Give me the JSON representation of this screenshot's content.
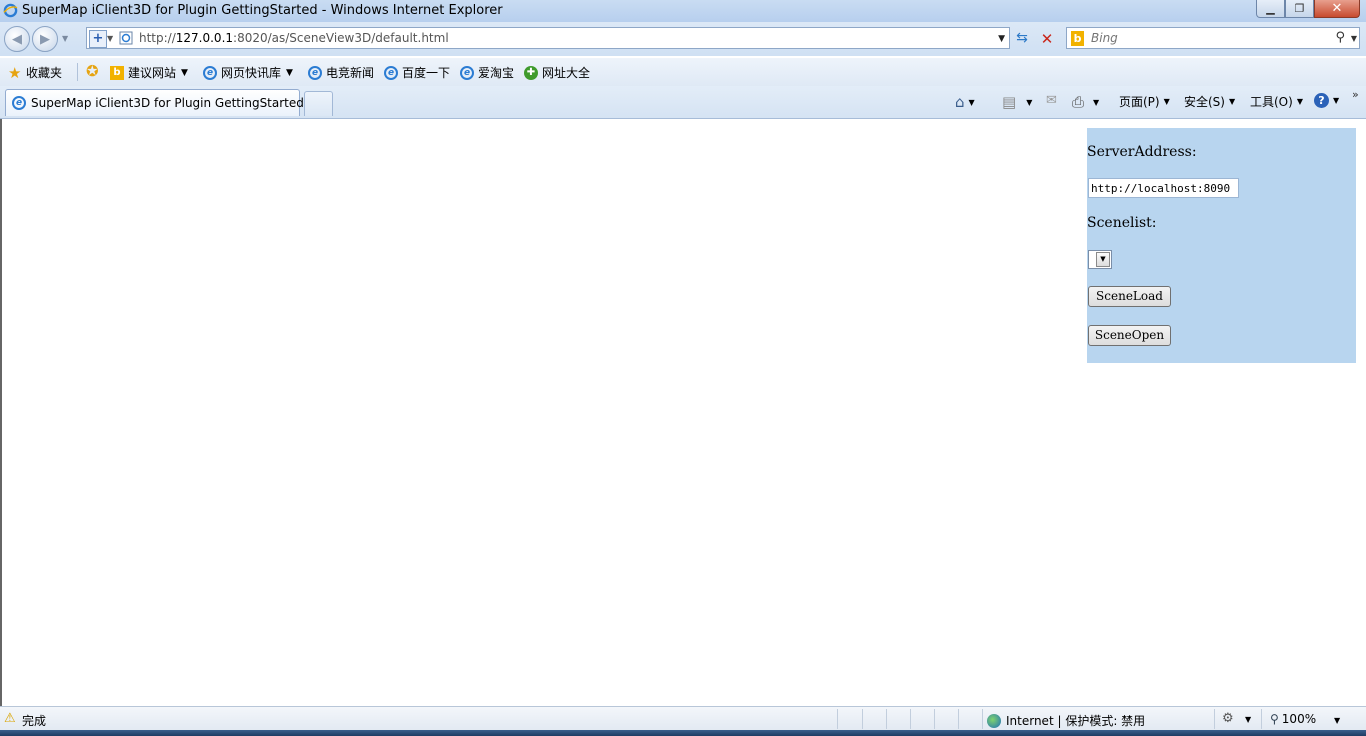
{
  "window": {
    "title": "SuperMap iClient3D for Plugin GettingStarted - Windows Internet Explorer",
    "minimize": "▁",
    "maximize": "❐",
    "close": "✕"
  },
  "nav": {
    "back_icon": "◀",
    "forward_icon": "▶",
    "address_url_prefix": "http://",
    "address_url_host": "127.0.0.1",
    "address_url_rest": ":8020/as/SceneView3D/default.html",
    "search_placeholder": "Bing"
  },
  "favorites": {
    "favorites_label": "收藏夹",
    "items": [
      {
        "label": "建议网站",
        "icon": "bing-icon",
        "has_dropdown": true
      },
      {
        "label": "网页快讯库",
        "icon": "ie-page-icon",
        "has_dropdown": true
      },
      {
        "label": "电竞新闻",
        "icon": "ie-page-icon",
        "has_dropdown": false
      },
      {
        "label": "百度一下",
        "icon": "ie-page-icon",
        "has_dropdown": false
      },
      {
        "label": "爱淘宝",
        "icon": "ie-page-icon",
        "has_dropdown": false
      },
      {
        "label": "网址大全",
        "icon": "green-globe-icon",
        "has_dropdown": false
      }
    ]
  },
  "tabs": {
    "active_tab_title": "SuperMap iClient3D for Plugin GettingStarted"
  },
  "command_bar": {
    "page_menu": "页面(P)",
    "safety_menu": "安全(S)",
    "tools_menu": "工具(O)"
  },
  "panel": {
    "server_address_label": "ServerAddress:",
    "server_address_value": "http://localhost:8090",
    "scenelist_label": "Scenelist:",
    "scene_load_button": "SceneLoad",
    "scene_open_button": "SceneOpen",
    "background_color": "#b8d5ef"
  },
  "status": {
    "text": "完成",
    "zone": "Internet | 保护模式: 禁用",
    "zoom": "100%"
  }
}
